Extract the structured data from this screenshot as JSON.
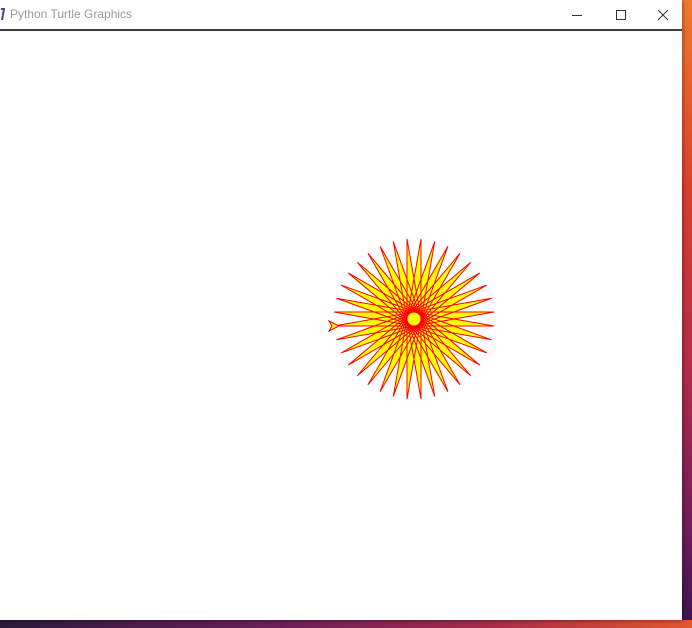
{
  "window": {
    "title": "Python Turtle Graphics",
    "icon": "turtle-app-icon",
    "controls": {
      "minimize_icon": "minimize-icon",
      "maximize_icon": "maximize-icon",
      "close_icon": "close-icon"
    }
  },
  "canvas": {
    "background": "#ffffff",
    "drawing": {
      "shape": "star",
      "pen_color": "#ff0000",
      "fill_color": "#ffff00",
      "turtle_cursor": "turtle-arrow-icon"
    }
  }
}
